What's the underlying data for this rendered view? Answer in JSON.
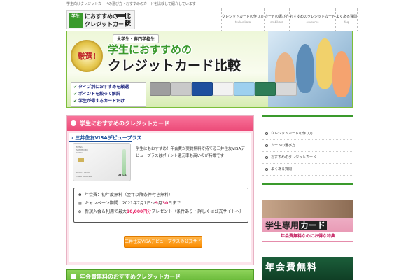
{
  "topline": {
    "text": "学生向けクレジットカードの選び方・おすすめのカードを比較して紹介しています"
  },
  "logo": {
    "badge": "学生",
    "line1": "におすすめの",
    "line2": "クレジットカード",
    "kanji": "比較"
  },
  "nav": [
    {
      "jp": "クレジットカードの作り方",
      "en": "tsukurikata"
    },
    {
      "jp": "カードの選び方",
      "en": "erabikata"
    },
    {
      "jp": "おすすめのクレジットカード",
      "en": "osusume"
    },
    {
      "jp": "よくある質問",
      "en": "faq"
    }
  ],
  "hero": {
    "medal": "厳選!",
    "subtitle": "大学生・専門学校生",
    "title1": "学生におすすめの",
    "title2": "クレジットカード比較",
    "checks": [
      "タイプ別におすすめを厳選",
      "ポイントを絞って解説",
      "学生が得するカードだけ"
    ],
    "cards": [
      {
        "color": "#9e9e9e"
      },
      {
        "color": "#c9c9c9"
      },
      {
        "color": "#1e4f9e"
      },
      {
        "color": "#f2f2f2"
      },
      {
        "color": "#9dd0ef"
      },
      {
        "color": "#2e7d57"
      },
      {
        "color": "#d8d8d8"
      }
    ]
  },
  "main": {
    "header": "学生におすすめのクレジットカード",
    "article_title": "三井住友VISAデビュープラス",
    "thumb_lines": [
      "MITSUI",
      "SUMITOMO",
      "CARD"
    ],
    "thumb_bottom": [
      "DEBUT PLUS",
      "TARO KOKUSAI"
    ],
    "thumb_brand": "VISA",
    "description": "学生にもおすすめ！年会費が実質無料で持てる三井住友VISAデビュープラスはポイント還元率も高いのが特徴です",
    "info": {
      "row1": "年会費：初年度無料（翌年以降条件付き無料）",
      "row2_prefix": "キャンペーン期間：2021年7月1日〜",
      "row2_red1": "9",
      "row2_mid": "月",
      "row2_red2": "30",
      "row2_suffix": "日まで",
      "row3_prefix": "新規入会＆利用で最大",
      "row3_amount": "10,000",
      "row3_unit": "円分",
      "row3_suffix": "プレゼント（条件あり・詳しくは公式サイトへ）"
    },
    "cta": "三井住友VISAデビュープラスの公式サイトへ"
  },
  "main2": {
    "header": "年会費無料のおすすめクレジットカード"
  },
  "sidebar": {
    "items": [
      "クレジットカードの作り方",
      "カードの選び方",
      "おすすめのクレジットカード",
      "よくある質問"
    ],
    "banner1_t1": "学生専用",
    "banner1_dark": "カード",
    "banner1_t2": "年会費無料なのにお得な特典",
    "banner2": "年会費無料"
  },
  "colors": {
    "accent_green": "#3a9a2c",
    "header_pink": "#ec4a78",
    "cta_orange": "#fb8c00",
    "highlight_red": "#d81b60"
  }
}
